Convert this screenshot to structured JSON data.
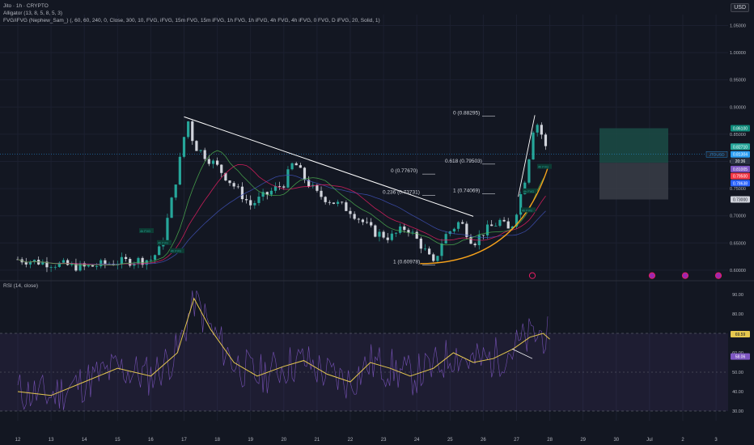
{
  "header": {
    "title": "Jito · 1h · CRYPTO",
    "alligator": "Alligator (13, 8, 5, 8, 5, 3)",
    "fvg": "FVG/iFVG (Nephew_Sam_) (, 60, 60, 240, 0, Close, 300, 10, FVG, iFVG, 15m FVG, 15m iFVG, 1h FVG, 1h iFVG, 4h FVG, 4h iFVG, 0 FVG, D iFVG, 20, Solid, 1)",
    "currency": "USD"
  },
  "rsi_title": "RSI (14, close)",
  "colors": {
    "background": "#131722",
    "candle_up": "#26a69a",
    "candle_down": "#d1d4dc",
    "rsi_line": "#7e57c2",
    "rsi_ma": "#e6c84f",
    "trendline": "#ffffff",
    "curve": "#f7a21b",
    "long_zone": "#1b4c45",
    "short_zone": "#3a3d47",
    "fvg": "#26a69a"
  },
  "chart_data": [
    {
      "type": "line",
      "title": "Jito · 1h · CRYPTO",
      "x_dates": [
        "12",
        "13",
        "14",
        "15",
        "16",
        "17",
        "18",
        "19",
        "20",
        "21",
        "22",
        "23",
        "24",
        "25",
        "26",
        "27",
        "28",
        "29",
        "30",
        "Jul",
        "2",
        "3"
      ],
      "ylim": [
        0.585,
        1.07
      ],
      "y_ticks": [
        "1.05000",
        "1.00000",
        "0.95000",
        "0.90000",
        "0.85000",
        "0.80000",
        "0.75000",
        "0.70000",
        "0.65000",
        "0.60000"
      ],
      "price_points": [
        [
          0,
          0.62
        ],
        [
          2,
          0.605
        ],
        [
          3,
          0.615
        ],
        [
          4,
          0.62
        ],
        [
          4.3,
          0.64
        ],
        [
          4.6,
          0.72
        ],
        [
          4.9,
          0.81
        ],
        [
          5.1,
          0.88
        ],
        [
          5.3,
          0.83
        ],
        [
          6,
          0.79
        ],
        [
          7,
          0.72
        ],
        [
          8,
          0.76
        ],
        [
          8.3,
          0.8
        ],
        [
          8.6,
          0.77
        ],
        [
          9,
          0.74
        ],
        [
          10,
          0.71
        ],
        [
          10.7,
          0.67
        ],
        [
          11.2,
          0.66
        ],
        [
          11.7,
          0.68
        ],
        [
          12.2,
          0.64
        ],
        [
          12.5,
          0.61
        ],
        [
          12.8,
          0.66
        ],
        [
          13.3,
          0.69
        ],
        [
          13.7,
          0.65
        ],
        [
          14,
          0.67
        ],
        [
          14.5,
          0.69
        ],
        [
          14.8,
          0.67
        ],
        [
          15,
          0.71
        ],
        [
          15.3,
          0.78
        ],
        [
          15.55,
          0.88
        ],
        [
          15.75,
          0.85
        ],
        [
          15.9,
          0.82
        ]
      ],
      "fib_levels": [
        {
          "label": "0 (0.88295)",
          "value": 0.88295
        },
        {
          "label": "0.618 (0.79503)",
          "value": 0.79503
        },
        {
          "label": "1 (0.74069)",
          "value": 0.74069
        },
        {
          "label": "0 (0.77670)",
          "value": 0.7767
        },
        {
          "label": "0.236 (0.73731)",
          "value": 0.73731
        },
        {
          "label": "1 (0.60978)",
          "value": 0.60978
        }
      ],
      "price_labels": [
        {
          "text": "0.86100",
          "value": 0.861,
          "color": "#0e8a7a"
        },
        {
          "text": "0.82710",
          "value": 0.8271,
          "color": "#26a69a"
        },
        {
          "text": "0.81304",
          "value": 0.81304,
          "color": "#2a9df4"
        },
        {
          "text": "20:36",
          "value": 0.8005,
          "color": "#2a3142"
        },
        {
          "text": "0.81005",
          "value": 0.786,
          "color": "#7e57c2"
        },
        {
          "text": "0.79500",
          "value": 0.773,
          "color": "#f23645"
        },
        {
          "text": "0.78638",
          "value": 0.76,
          "color": "#2962ff"
        },
        {
          "text": "0.73000",
          "value": 0.73,
          "color": "#d1d4dc"
        }
      ],
      "symbol_label": "JTOUSD",
      "fvg_tags": [
        "4h FVG",
        "4h FVG",
        "4h FVG",
        "4h FVG",
        "4h FVG",
        "4h FVG"
      ]
    },
    {
      "type": "line",
      "title": "RSI (14, close)",
      "ylim": [
        25,
        95
      ],
      "y_ticks": [
        "90.00",
        "80.00",
        "70.00",
        "60.00",
        "50.00",
        "40.00",
        "30.00"
      ],
      "bands": [
        70,
        30
      ],
      "mid": 50,
      "rsi_label": "69.59",
      "rsi_ma_label": "58.06",
      "ma_points": [
        [
          0,
          40
        ],
        [
          1,
          38
        ],
        [
          2,
          45
        ],
        [
          3,
          52
        ],
        [
          4,
          48
        ],
        [
          4.8,
          60
        ],
        [
          5.3,
          88
        ],
        [
          5.8,
          72
        ],
        [
          6.5,
          55
        ],
        [
          7.2,
          48
        ],
        [
          8,
          53
        ],
        [
          8.6,
          56
        ],
        [
          9.3,
          49
        ],
        [
          10,
          45
        ],
        [
          10.6,
          55
        ],
        [
          11.2,
          52
        ],
        [
          11.8,
          48
        ],
        [
          12.5,
          52
        ],
        [
          13.1,
          60
        ],
        [
          13.7,
          55
        ],
        [
          14.3,
          57
        ],
        [
          14.9,
          62
        ],
        [
          15.4,
          68
        ],
        [
          15.8,
          70
        ],
        [
          16,
          67
        ]
      ]
    }
  ]
}
